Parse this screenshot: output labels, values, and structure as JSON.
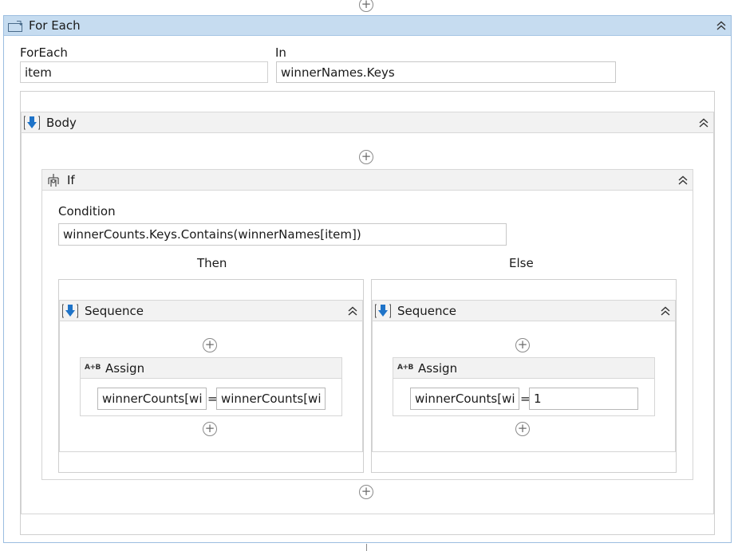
{
  "foreach": {
    "title": "For Each",
    "foreach_label": "ForEach",
    "item_value": "item",
    "in_label": "In",
    "in_value": "winnerNames.Keys"
  },
  "body": {
    "title": "Body"
  },
  "if_block": {
    "title": "If",
    "condition_label": "Condition",
    "condition_value": "winnerCounts.Keys.Contains(winnerNames[item])",
    "then_label": "Then",
    "else_label": "Else"
  },
  "then_branch": {
    "sequence_title": "Sequence",
    "assign_title": "Assign",
    "assign_icon_text": "A+B",
    "to_value": "winnerCounts[wi",
    "equals": "=",
    "value": "winnerCounts[wi"
  },
  "else_branch": {
    "sequence_title": "Sequence",
    "assign_title": "Assign",
    "assign_icon_text": "A+B",
    "to_value": "winnerCounts[wi",
    "equals": "=",
    "value": "1"
  },
  "icons": {
    "add": "plus-circle",
    "collapse": "double-chevron-up",
    "foreach": "foreach-bracket",
    "sequence": "sequence-arrow-down",
    "if": "if-branch",
    "assign": "assign-ab"
  },
  "colors": {
    "foreach_header": "#c6dcf0",
    "activity_header": "#f2f2f2",
    "sequence_icon_blue": "#1e73c8",
    "field_border_focus": "#7eb4ea"
  }
}
